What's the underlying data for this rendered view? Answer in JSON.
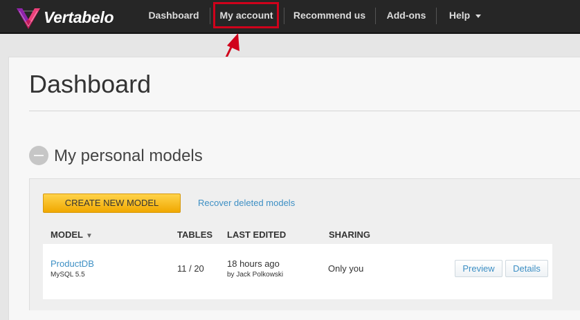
{
  "brand": {
    "name": "Vertabelo"
  },
  "nav": {
    "dashboard": "Dashboard",
    "my_account": "My account",
    "recommend": "Recommend us",
    "addons": "Add-ons",
    "help": "Help"
  },
  "annotation": {
    "highlight_color": "#d0021b"
  },
  "page": {
    "title": "Dashboard"
  },
  "section": {
    "title": "My personal models"
  },
  "actions": {
    "create": "CREATE NEW MODEL",
    "recover": "Recover deleted models"
  },
  "table": {
    "headers": {
      "model": "MODEL",
      "sort_indicator": "▼",
      "tables": "TABLES",
      "last_edited": "LAST EDITED",
      "sharing": "SHARING"
    },
    "rows": [
      {
        "name": "ProductDB",
        "db": "MySQL 5.5",
        "tables": "11 / 20",
        "edited": "18 hours ago",
        "edited_by": "by Jack Polkowski",
        "sharing": "Only you",
        "preview": "Preview",
        "details": "Details"
      }
    ]
  },
  "colors": {
    "accent": "#3d8fc4",
    "button": "#f5b800",
    "topbar": "#262626"
  }
}
